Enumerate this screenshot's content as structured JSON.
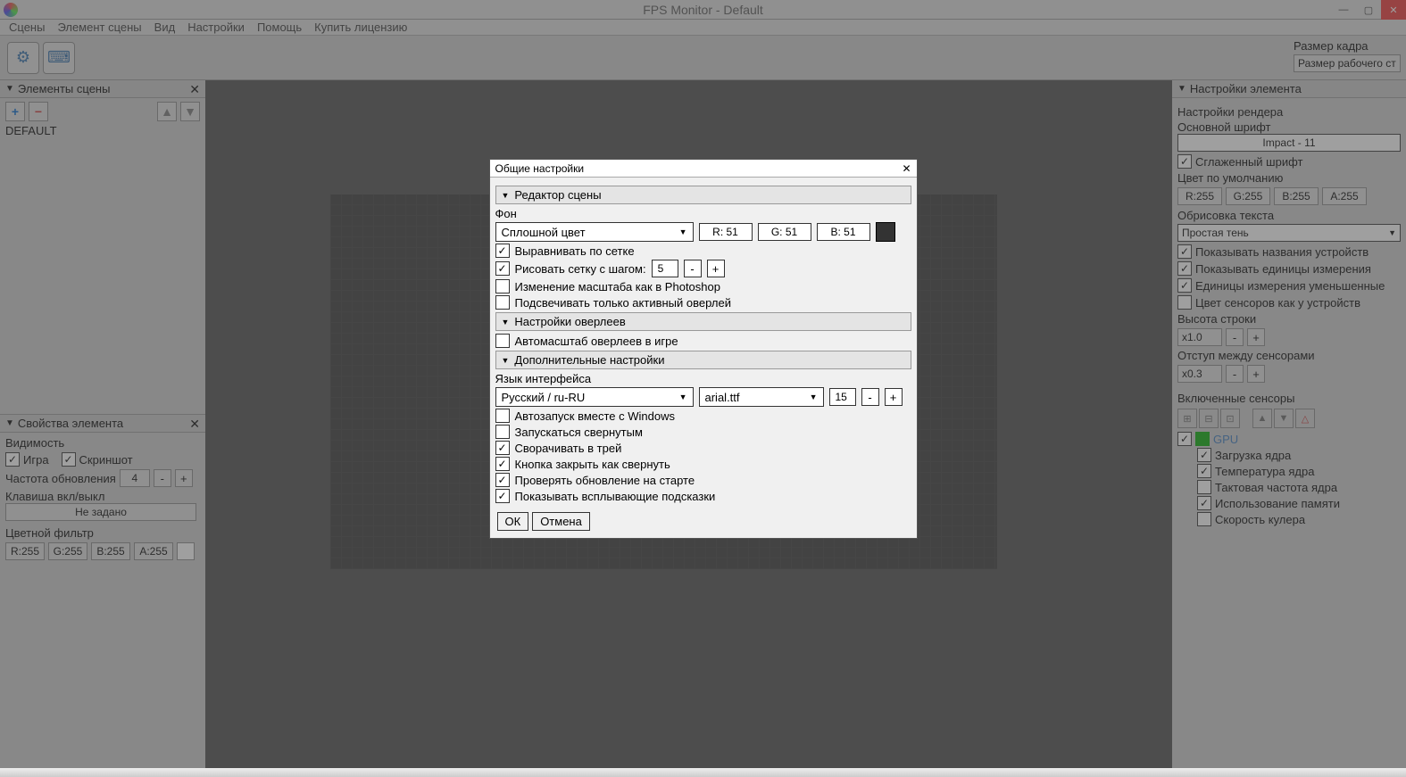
{
  "window": {
    "title": "FPS Monitor - Default"
  },
  "menu": {
    "scenes": "Сцены",
    "scene_element": "Элемент сцены",
    "view": "Вид",
    "settings": "Настройки",
    "help": "Помощь",
    "buy": "Купить лицензию"
  },
  "frame": {
    "label": "Размер кадра",
    "value": "Размер рабочего ст"
  },
  "elements_panel": {
    "title": "Элементы сцены",
    "default_item": "DEFAULT"
  },
  "props_panel": {
    "title": "Свойства элемента",
    "visibility_label": "Видимость",
    "game": "Игра",
    "screenshot": "Скриншот",
    "refresh_rate_label": "Частота обновления",
    "refresh_rate_value": "4",
    "toggle_key_label": "Клавиша вкл/выкл",
    "toggle_key_value": "Не задано",
    "color_filter_label": "Цветной фильтр",
    "r": "R:255",
    "g": "G:255",
    "b": "B:255",
    "a": "A:255"
  },
  "right_panel": {
    "title": "Настройки элемента",
    "render_settings": "Настройки рендера",
    "main_font_label": "Основной шрифт",
    "main_font_value": "Impact - 11",
    "antialiased": "Сглаженный шрифт",
    "default_color_label": "Цвет по умолчанию",
    "r": "R:255",
    "g": "G:255",
    "b": "B:255",
    "a": "A:255",
    "text_outline_label": "Обрисовка текста",
    "text_outline_value": "Простая тень",
    "show_device_names": "Показывать названия устройств",
    "show_units": "Показывать единицы измерения",
    "units_reduced": "Единицы измерения уменьшенные",
    "sensor_colors_device": "Цвет сенсоров как у устройств",
    "line_height_label": "Высота строки",
    "line_height_value": "x1.0",
    "sensor_gap_label": "Отступ между сенсорами",
    "sensor_gap_value": "x0.3",
    "enabled_sensors_label": "Включенные сенсоры",
    "gpu": "GPU",
    "sensors": {
      "core_load": "Загрузка ядра",
      "core_temp": "Температура ядра",
      "core_clock": "Тактовая частота ядра",
      "mem_usage": "Использование памяти",
      "fan_speed": "Скорость кулера"
    }
  },
  "modal": {
    "title": "Общие настройки",
    "section_editor": "Редактор сцены",
    "bg_label": "Фон",
    "bg_value": "Сплошной цвет",
    "bg_r": "R: 51",
    "bg_g": "G: 51",
    "bg_b": "B: 51",
    "align_grid": "Выравнивать по сетке",
    "draw_grid_label": "Рисовать сетку с шагом:",
    "draw_grid_value": "5",
    "photoshop_zoom": "Изменение масштаба как в Photoshop",
    "highlight_active": "Подсвечивать только активный оверлей",
    "section_overlay": "Настройки оверлеев",
    "autoscale": "Автомасштаб оверлеев в игре",
    "section_additional": "Дополнительные настройки",
    "language_label": "Язык интерфейса",
    "language_value": "Русский / ru-RU",
    "font_file": "arial.ttf",
    "font_size": "15",
    "autostart": "Автозапуск вместе с Windows",
    "start_minimized": "Запускаться свернутым",
    "minimize_tray": "Сворачивать в трей",
    "close_as_minimize": "Кнопка закрыть как свернуть",
    "check_updates": "Проверять обновление на старте",
    "show_tooltips": "Показывать всплывающие подсказки",
    "ok": "ОК",
    "cancel": "Отмена"
  }
}
